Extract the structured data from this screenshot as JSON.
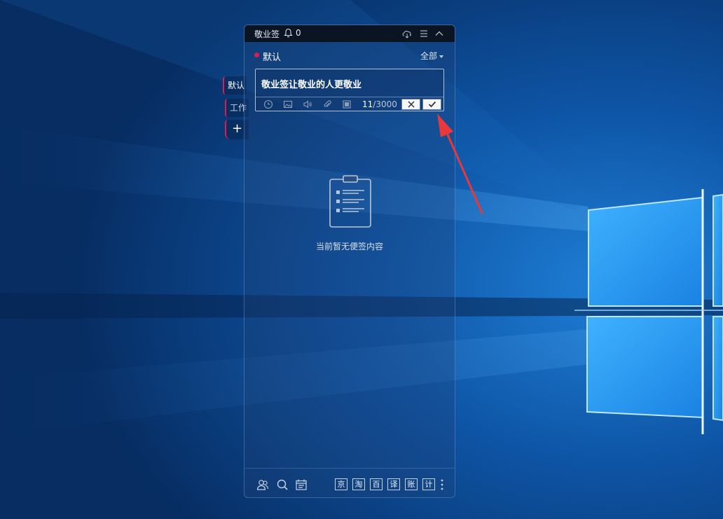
{
  "window": {
    "title": "敬业签",
    "notification_count": "0",
    "icons": [
      "cloud-sync-icon",
      "menu-icon",
      "collapse-icon"
    ]
  },
  "side_tabs": [
    {
      "label": "默认"
    },
    {
      "label": "工作"
    },
    {
      "label": "+"
    }
  ],
  "category": {
    "label": "默认",
    "filter": "全部",
    "color": "#d81e54"
  },
  "editor": {
    "text": "敬业签让敬业的人更敬业",
    "count": "11",
    "max": "/3000",
    "tools": [
      "clock-icon",
      "image-icon",
      "speaker-icon",
      "attachment-icon",
      "stop-icon"
    ]
  },
  "empty_state": {
    "icon": "clipboard-icon",
    "text": "当前暂无便签内容"
  },
  "bottom_bar": {
    "icons": [
      "users-icon",
      "search-icon",
      "calendar-icon"
    ],
    "quick_links": [
      "京",
      "淘",
      "百",
      "译",
      "账",
      "计"
    ]
  }
}
